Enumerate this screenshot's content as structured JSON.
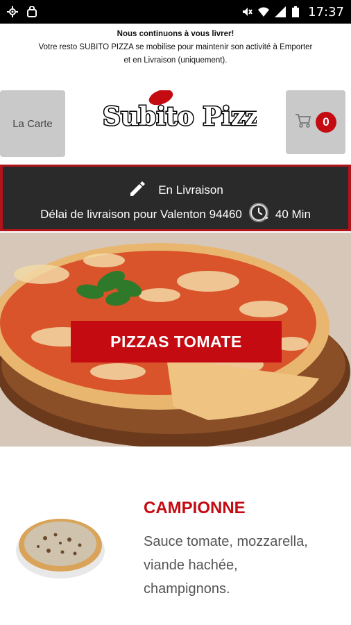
{
  "status_bar": {
    "time": "17:37"
  },
  "notice": {
    "line1": "Nous continuons à vous livrer!",
    "line2": "Votre resto SUBITO PIZZA se mobilise pour maintenir son activité à Emporter",
    "line3": "et en Livraison (uniquement)."
  },
  "header": {
    "menu_label": "La Carte",
    "logo_text": "Subito Pizza",
    "cart_count": "0"
  },
  "delivery": {
    "mode": "En Livraison",
    "info": "Délai de livraison pour Valenton 94460",
    "time": "40 Min"
  },
  "hero": {
    "button_label": "PIZZAS TOMATE"
  },
  "product": {
    "name": "CAMPIONNE",
    "description": "Sauce tomate, mozzarella, viande hachée, champignons."
  },
  "colors": {
    "brand_red": "#c40b12",
    "dark_bar": "#2a2a2a",
    "button_gray": "#c9c9c9"
  }
}
